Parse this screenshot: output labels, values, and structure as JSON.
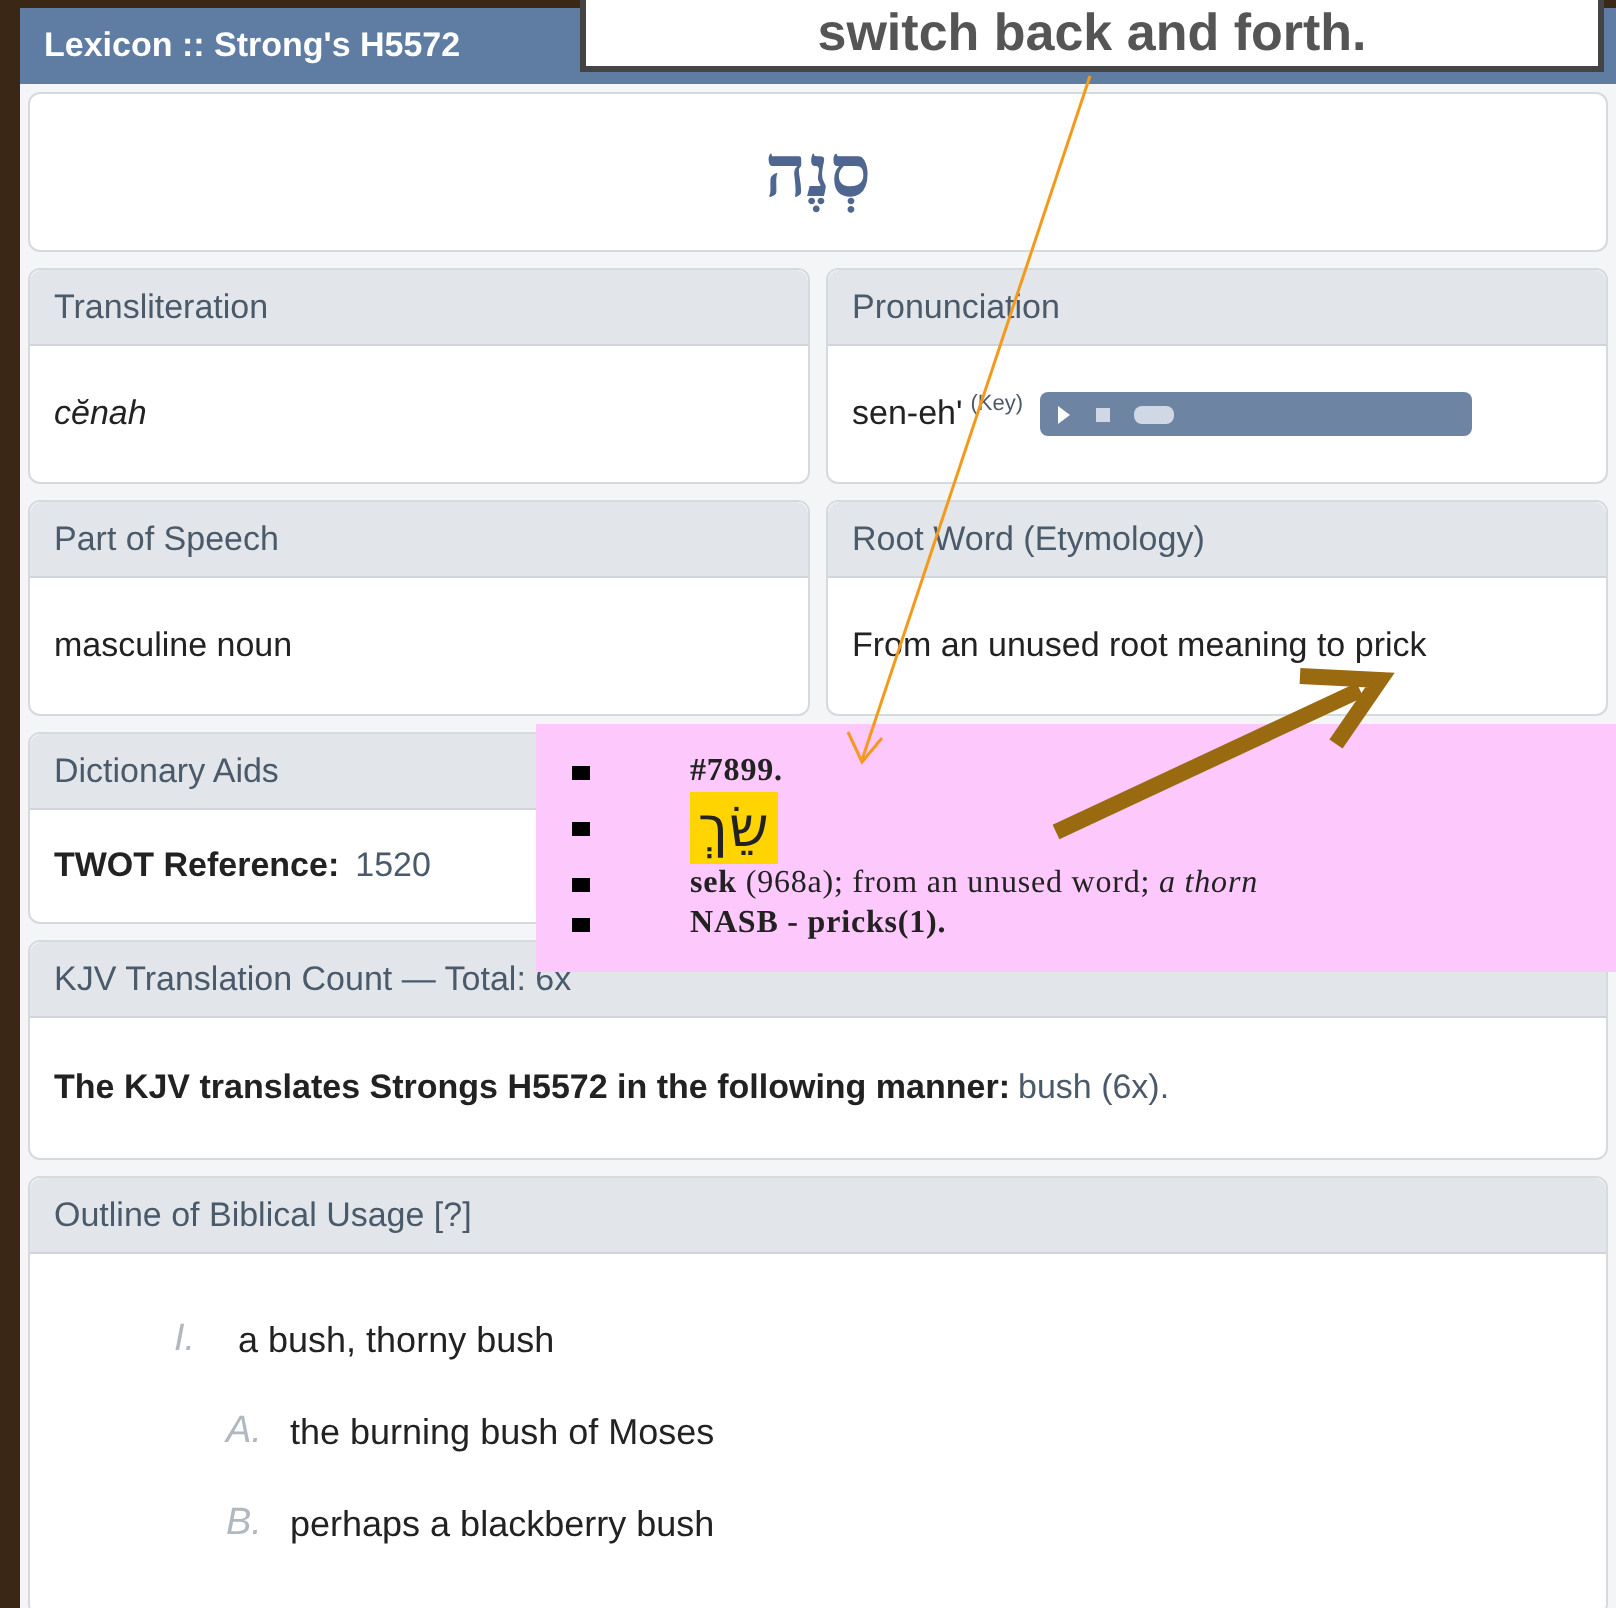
{
  "window": {
    "title": "Lexicon :: Strong's H5572"
  },
  "callout": {
    "text": "switch back and forth."
  },
  "headword": "סְנֶה",
  "fields": [
    {
      "label": "Transliteration",
      "value": "cĕnah",
      "kind": "italic"
    },
    {
      "label": "Pronunciation",
      "value": "sen-eh'",
      "kind": "audio",
      "key_link": "(Key)"
    },
    {
      "label": "Part of Speech",
      "value": "masculine noun",
      "kind": "text"
    },
    {
      "label": "Root Word (Etymology)",
      "value": "From an unused root meaning to prick",
      "kind": "text"
    }
  ],
  "dictionary_aids": {
    "label": "Dictionary Aids",
    "entry_label": "TWOT Reference:",
    "entry_value": "1520"
  },
  "kjv": {
    "label": "KJV Translation Count — Total: 6x",
    "sentence": "The KJV translates Strongs H5572 in the following manner:",
    "link": "bush (6x)."
  },
  "outline": {
    "label": "Outline of Biblical Usage [?]",
    "items": [
      {
        "marker": "I.",
        "text": "a bush, thorny bush",
        "children": [
          {
            "marker": "A.",
            "text": "the burning bush of Moses"
          },
          {
            "marker": "B.",
            "text": "perhaps a blackberry bush"
          }
        ]
      }
    ]
  },
  "popup": {
    "items": [
      {
        "kind": "number",
        "text": "**#7899.**"
      },
      {
        "kind": "hebrew",
        "text": "שֵׂךְ"
      },
      {
        "kind": "rich",
        "text": "**sek** (968a); from an unused word; *a thorn*"
      },
      {
        "kind": "bold",
        "text": "**NASB - pricks(1).**"
      }
    ]
  }
}
